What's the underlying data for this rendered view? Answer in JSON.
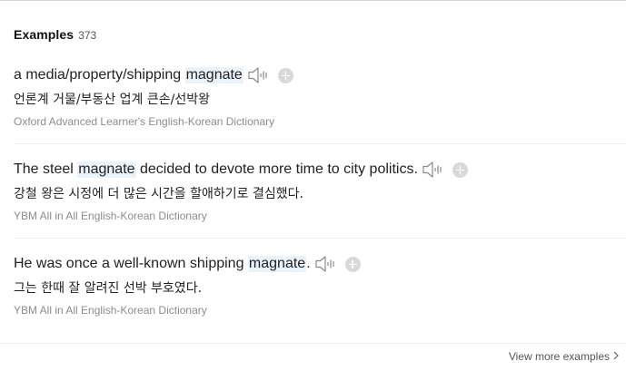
{
  "header": {
    "title": "Examples",
    "count": "373"
  },
  "examples": [
    {
      "parts": [
        "a media/property/shipping ",
        "magnate",
        ""
      ],
      "translation": "언론계 거물/부동산 업계 큰손/선박왕",
      "source": "Oxford Advanced Learner's English-Korean Dictionary"
    },
    {
      "parts": [
        "The steel ",
        "magnate",
        " decided to devote more time to city politics."
      ],
      "translation": "강철 왕은 시정에 더 많은 시간을 할애하기로 결심했다.",
      "source": "YBM All in All English-Korean Dictionary"
    },
    {
      "parts": [
        "He was once a well-known shipping ",
        "magnate",
        "."
      ],
      "translation": "그는 한때 잘 알려진 선박 부호였다.",
      "source": "YBM All in All English-Korean Dictionary"
    }
  ],
  "icons": {
    "speaker": "speaker-icon",
    "add": "plus-circle-icon",
    "chevron": "chevron-right-icon"
  },
  "colors": {
    "highlight": "#e9f3fc",
    "source_text": "#8c8c8c",
    "plus_bg": "#d9d9d9"
  },
  "footer": {
    "view_more": "View more examples"
  }
}
